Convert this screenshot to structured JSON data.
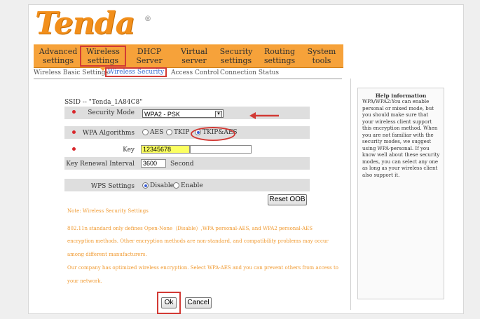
{
  "brand": {
    "logo_text": "Tenda",
    "registered": "®"
  },
  "nav": {
    "items": [
      {
        "label_1": "Advanced",
        "label_2": "settings"
      },
      {
        "label_1": "Wireless",
        "label_2": "settings"
      },
      {
        "label_1": "DHCP",
        "label_2": "Server"
      },
      {
        "label_1": "Virtual",
        "label_2": "server"
      },
      {
        "label_1": "Security",
        "label_2": "settings"
      },
      {
        "label_1": "Routing",
        "label_2": "settings"
      },
      {
        "label_1": "System",
        "label_2": "tools"
      }
    ]
  },
  "subnav": {
    "items": [
      "Wireless Basic Settings",
      "Wireless Security",
      "Access Control",
      "Connection Status"
    ]
  },
  "form": {
    "ssid": "SSID -- \"Tenda_1A84C8\"",
    "security_mode_label": "Security Mode",
    "security_mode_value": "WPA2 - PSK",
    "wpa_algorithms_label": "WPA Algorithms",
    "algo_options": [
      "AES",
      "TKIP",
      "TKIP&AES"
    ],
    "algo_selected": "TKIP&AES",
    "key_label": "Key",
    "key_value": "12345678",
    "key_renewal_label": "Key Renewal Interval",
    "key_renewal_value": "3600",
    "key_renewal_unit": "Second",
    "wps_label": "WPS Settings",
    "wps_options": [
      "Disable",
      "Enable"
    ],
    "wps_selected": "Disable",
    "reset_oob": "Reset OOB",
    "ok": "Ok",
    "cancel": "Cancel"
  },
  "note": {
    "lines": [
      "Note: Wireless Security Settings",
      "802.11n standard only defines Open-None（Disable）,WPA personal-AES, and WPA2 personal-AES",
      "encryption methods. Other encryption methods are non-standard, and compatibility problems may occur",
      "among different manufacturers.",
      "Our company has optimized wireless encryption. Select WPA-AES and you can prevent others from access to",
      "your network."
    ]
  },
  "help": {
    "title": "Help information",
    "body": "WPA/WPA2:You can enable personal or mixed mode, but you should make sure that your wireless client support this encryption method. When you are not familiar with the security modes, we suggest using WPA-personal. If you know well about these security modes, you can select any one as long as your wireless client also support it."
  },
  "colors": {
    "orange": "#f6a23a",
    "highlight_red": "#d23a35",
    "note_orange": "#f09a31",
    "key_highlight": "#fbff61"
  }
}
